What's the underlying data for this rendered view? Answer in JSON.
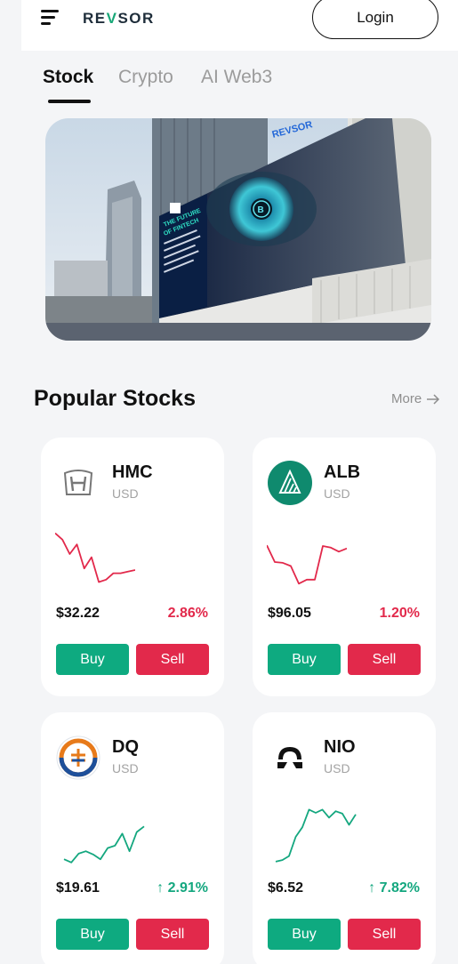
{
  "header": {
    "logo_prefix": "RE",
    "logo_v": "V",
    "logo_suffix": "SOR",
    "login_label": "Login"
  },
  "tabs": [
    {
      "label": "Stock",
      "active": true
    },
    {
      "label": "Crypto",
      "active": false
    },
    {
      "label": "AI Web3",
      "active": false
    }
  ],
  "banner": {
    "brand": "REVSOR",
    "headline_1": "THE FUTURE",
    "headline_2": "OF FINTECH"
  },
  "popular": {
    "title": "Popular Stocks",
    "more_label": "More"
  },
  "stocks": [
    {
      "ticker": "HMC",
      "currency": "USD",
      "price": "$32.22",
      "change": "2.86%",
      "direction": "down",
      "buy_label": "Buy",
      "sell_label": "Sell",
      "logo_icon": "honda-logo-icon",
      "spark": [
        7.6,
        6.8,
        5.0,
        6.2,
        3.2,
        4.6,
        1.5,
        1.8,
        2.6,
        2.6,
        2.8,
        3.0
      ]
    },
    {
      "ticker": "ALB",
      "currency": "USD",
      "price": "$96.05",
      "change": "1.20%",
      "direction": "down",
      "buy_label": "Buy",
      "sell_label": "Sell",
      "logo_icon": "albemarle-logo-icon",
      "spark": [
        6.1,
        4.0,
        3.9,
        3.5,
        1.3,
        1.8,
        1.8,
        6.0,
        5.8,
        5.3,
        5.7
      ]
    },
    {
      "ticker": "DQ",
      "currency": "USD",
      "price": "$19.61",
      "change": "2.91%",
      "direction": "up",
      "buy_label": "Buy",
      "sell_label": "Sell",
      "logo_icon": "daqo-logo-icon",
      "spark": [
        1.2,
        0.8,
        1.9,
        2.2,
        1.8,
        1.2,
        2.6,
        2.9,
        4.4,
        2.2,
        4.6,
        5.3
      ]
    },
    {
      "ticker": "NIO",
      "currency": "USD",
      "price": "$6.52",
      "change": "7.82%",
      "direction": "up",
      "buy_label": "Buy",
      "sell_label": "Sell",
      "logo_icon": "nio-logo-icon",
      "spark": [
        0.9,
        1.1,
        1.6,
        4.0,
        5.2,
        7.4,
        7.0,
        7.4,
        6.4,
        7.2,
        6.9,
        5.5,
        6.8
      ]
    }
  ],
  "colors": {
    "buy": "#0eaa80",
    "sell": "#e2294b",
    "up": "#14a77f",
    "down": "#e2294b"
  }
}
